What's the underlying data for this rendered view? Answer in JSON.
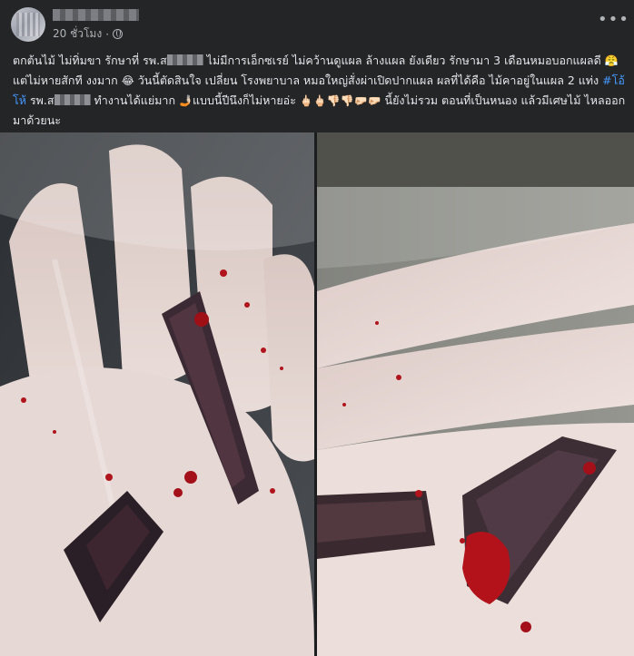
{
  "post": {
    "time": "20 ชั่วโมง",
    "separator": "·",
    "more_icon": "more-horizontal-icon",
    "text": {
      "p1": "ตกต้นไม้ ไม่ทิ่มขา รักษาที่ รพ.ส",
      "p2": " ไม่มีการเอ็กซเรย์ ไม่คว้านดูแผล ล้างแผล ยังเดียว รักษามา 3 เดือนหมอบอกแผลดี ",
      "e1": "😤",
      "p3": " แต่ไม่หายสักที งงมาก ",
      "e2": "😂",
      "p4": " วันนี้ตัดสินใจ เปลี่ยน โรงพยาบาล หมอใหญ่สั่งผ่าเปิดปากแผล ผลที่ได้คือ ไม้คาอยู่ในแผล 2 แท่ง ",
      "hashtag": "#โอ้โห้",
      "p5": " รพ.ส",
      "p6": " ทำงานได้แย่มาก ",
      "e3": "🤳🏻",
      "p7": "แบบนี้ปีนึงก็ไม่หายอ่ะ ",
      "e4": "🖕🏻🖕🏻👎🏻👎🏻🤛🏻🤛🏻",
      "p8": " นี้ยังไม่รวม ตอนที่เป็นหนอง แล้วมีเศษไม้ ไหลออกมาด้วยนะ"
    }
  },
  "photos": [
    {
      "name": "left-photo"
    },
    {
      "name": "right-photo"
    }
  ]
}
